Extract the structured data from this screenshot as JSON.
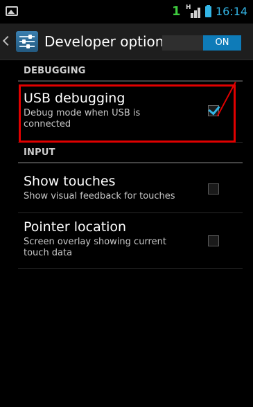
{
  "status_bar": {
    "sim_indicator": "1",
    "network_type": "H",
    "time": "16:14",
    "icons": [
      "gallery-notification-icon",
      "sim-one-icon",
      "hspa-signal-icon",
      "battery-icon"
    ]
  },
  "action_bar": {
    "title": "Developer options",
    "master_switch": "ON",
    "icon": "settings-sliders-icon"
  },
  "sections": [
    {
      "header": "DEBUGGING",
      "items": [
        {
          "title": "USB debugging",
          "summary": "Debug mode when USB is connected",
          "checked": true
        }
      ]
    },
    {
      "header": "INPUT",
      "items": [
        {
          "title": "Show touches",
          "summary": "Show visual feedback for touches",
          "checked": false
        },
        {
          "title": "Pointer location",
          "summary": "Screen overlay showing current touch data",
          "checked": false
        }
      ]
    }
  ],
  "colors": {
    "accent": "#33b5e5",
    "switch_on": "#0e7bb8",
    "highlight": "#e00000",
    "sim_green": "#3fcc3f"
  }
}
